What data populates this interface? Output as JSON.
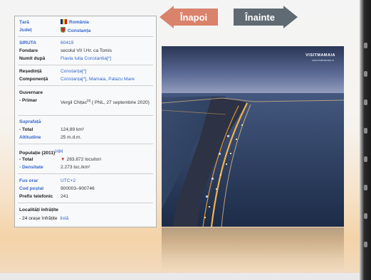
{
  "nav": {
    "back_label": "Înapoi",
    "forward_label": "Înainte"
  },
  "colors": {
    "back_button": "#d9826c",
    "forward_button": "#5f6a72",
    "link": "#3366cc",
    "decrease_marker": "#c0392b"
  },
  "infobox": {
    "tara": {
      "label": "Țară",
      "value": "România"
    },
    "judet": {
      "label": "Județ",
      "value": "Constanța"
    },
    "siruta": {
      "label": "SIRUTA",
      "value": "60419"
    },
    "fondare": {
      "label": "Fondare",
      "value": "secolul VII î.Hr. ca Tomis"
    },
    "numit_dupa": {
      "label": "Numit după",
      "value": "Flavia Iulia Constantia[*]"
    },
    "resedinta": {
      "label": "Reședință",
      "value": "Constanța[*]"
    },
    "componenta": {
      "label": "Componență",
      "value": "Constanța[*], Mamaia, Palazu Mare"
    },
    "guvernare": {
      "heading": "Guvernare",
      "primar_label": "- Primar",
      "primar_value": "Vergil Chițac",
      "primar_ref": "[3]",
      "primar_detail": "( PNL, 27 septembrie 2020)"
    },
    "suprafata": {
      "heading": "Suprafață",
      "total_label": "- Total",
      "total_value": "124,89 km²"
    },
    "altitudine": {
      "label": "Altitudine",
      "value": "25 m.d.m."
    },
    "populatie": {
      "heading": "Populație (2011)",
      "heading_ref": "[1][2]",
      "total_label": "- Total",
      "total_value": "283.872 locuitori",
      "densitate_label": "- Densitate",
      "densitate_value": "2.273 loc./km²"
    },
    "fus_orar": {
      "label": "Fus orar",
      "value": "UTC+2"
    },
    "cod_postal": {
      "label": "Cod poștal",
      "value": "900003–900746"
    },
    "prefix": {
      "label": "Prefix telefonic",
      "value": "241"
    },
    "infratite": {
      "heading": "Localități înfrățite",
      "label": "- 24 orașe înfrățite",
      "value": "listă"
    }
  },
  "photo": {
    "brand": "VISITMAMAIA",
    "brand_sub": "www.visitmamaia.ro",
    "icon": "aerial-city-night-photo"
  }
}
